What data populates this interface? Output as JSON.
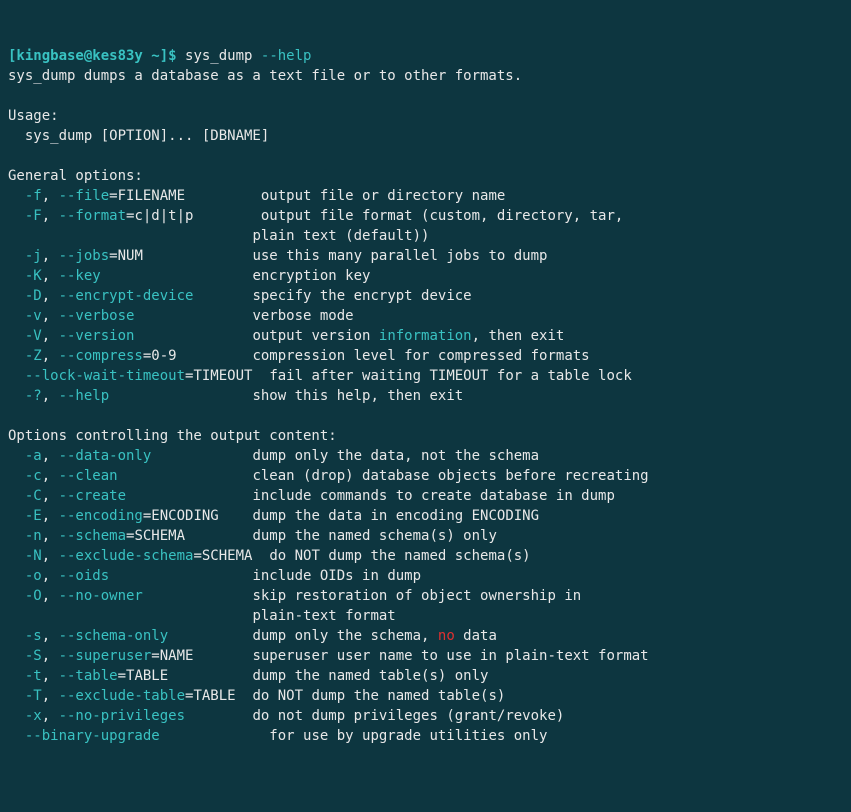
{
  "prompt": {
    "user": "kingbase",
    "host": "kes83y",
    "path": "~",
    "sep": "]$",
    "cmd": "sys_dump",
    "arg": "--help",
    "full_prefix": "[kingbase@kes83y ~]$ "
  },
  "desc": "sys_dump dumps a database as a text file or to other formats.",
  "usage_label": "Usage:",
  "usage_line": "  sys_dump [OPTION]... [DBNAME]",
  "general_header": "General options:",
  "general": {
    "f_short": "  -f",
    "f_sep": ", ",
    "f_long": "--file",
    "f_eq": "=FILENAME         ",
    "f_desc": "output file or directory name",
    "F_short": "  -F",
    "F_sep": ", ",
    "F_long": "--format",
    "F_eq": "=c|d|t|p        ",
    "F_desc": "output file format (custom, directory, tar,",
    "F_desc2_pad": "                             ",
    "F_desc2": "plain text (default))",
    "j_short": "  -j",
    "j_sep": ", ",
    "j_long": "--jobs",
    "j_eq": "=NUM             ",
    "j_desc": "use this many parallel jobs to dump",
    "K_short": "  -K",
    "K_sep": ", ",
    "K_long": "--key",
    "K_eq": "                  ",
    "K_desc": "encryption key",
    "D_short": "  -D",
    "D_sep": ", ",
    "D_long": "--encrypt-device",
    "D_eq": "       ",
    "D_desc": "specify the encrypt device",
    "v_short": "  -v",
    "v_sep": ", ",
    "v_long": "--verbose",
    "v_eq": "              ",
    "v_desc": "verbose mode",
    "V_short": "  -V",
    "V_sep": ", ",
    "V_long": "--version",
    "V_eq": "              ",
    "V_desc_a": "output version ",
    "V_desc_info": "information",
    "V_desc_b": ", then exit",
    "Z_short": "  -Z",
    "Z_sep": ", ",
    "Z_long": "--compress",
    "Z_eq": "=0-9         ",
    "Z_desc": "compression level for compressed formats",
    "lwt_pre": "  ",
    "lwt_long": "--lock-wait-timeout",
    "lwt_eq": "=TIMEOUT  ",
    "lwt_desc": "fail after waiting TIMEOUT for a table lock",
    "q_short": "  -?",
    "q_sep": ", ",
    "q_long": "--help",
    "q_eq": "                 ",
    "q_desc": "show this help, then exit"
  },
  "output_header": "Options controlling the output content:",
  "out": {
    "a_short": "  -a",
    "a_sep": ", ",
    "a_long": "--data-only",
    "a_eq": "            ",
    "a_desc": "dump only the data, not the schema",
    "c_short": "  -c",
    "c_sep": ", ",
    "c_long": "--clean",
    "c_eq": "                ",
    "c_desc": "clean (drop) database objects before recreating",
    "C_short": "  -C",
    "C_sep": ", ",
    "C_long": "--create",
    "C_eq": "               ",
    "C_desc": "include commands to create database in dump",
    "E_short": "  -E",
    "E_sep": ", ",
    "E_long": "--encoding",
    "E_eq": "=ENCODING    ",
    "E_desc": "dump the data in encoding ENCODING",
    "n_short": "  -n",
    "n_sep": ", ",
    "n_long": "--schema",
    "n_eq": "=SCHEMA        ",
    "n_desc": "dump the named schema(s) only",
    "N_short": "  -N",
    "N_sep": ", ",
    "N_long": "--exclude-schema",
    "N_eq": "=SCHEMA",
    "N_sp": "  ",
    "N_desc": "do NOT dump the named schema(s)",
    "o_short": "  -o",
    "o_sep": ", ",
    "o_long": "--oids",
    "o_eq": "                 ",
    "o_desc": "include OIDs in dump",
    "O_short": "  -O",
    "O_sep": ", ",
    "O_long": "--no-owner",
    "O_eq": "             ",
    "O_desc": "skip restoration of object ownership in",
    "O_desc2_pad": "                             ",
    "O_desc2": "plain-text format",
    "s_short": "  -s",
    "s_sep": ", ",
    "s_long": "--schema-only",
    "s_eq": "          ",
    "s_desc_a": "dump only the schema, ",
    "s_desc_no": "no",
    "s_desc_b": " data",
    "S_short": "  -S",
    "S_sep": ", ",
    "S_long": "--superuser",
    "S_eq": "=NAME       ",
    "S_desc": "superuser user name to use in plain-text format",
    "t_short": "  -t",
    "t_sep": ", ",
    "t_long": "--table",
    "t_eq": "=TABLE          ",
    "t_desc": "dump the named table(s) only",
    "T_short": "  -T",
    "T_sep": ", ",
    "T_long": "--exclude-table",
    "T_eq": "=TABLE  ",
    "T_desc": "do NOT dump the named table(s)",
    "x_short": "  -x",
    "x_sep": ", ",
    "x_long": "--no-privileges",
    "x_eq": "        ",
    "x_desc": "do not dump privileges (grant/revoke)",
    "bu_pre": "  ",
    "bu_long": "--binary-upgrade",
    "bu_eq": "             ",
    "bu_desc": "for use by upgrade utilities only"
  }
}
